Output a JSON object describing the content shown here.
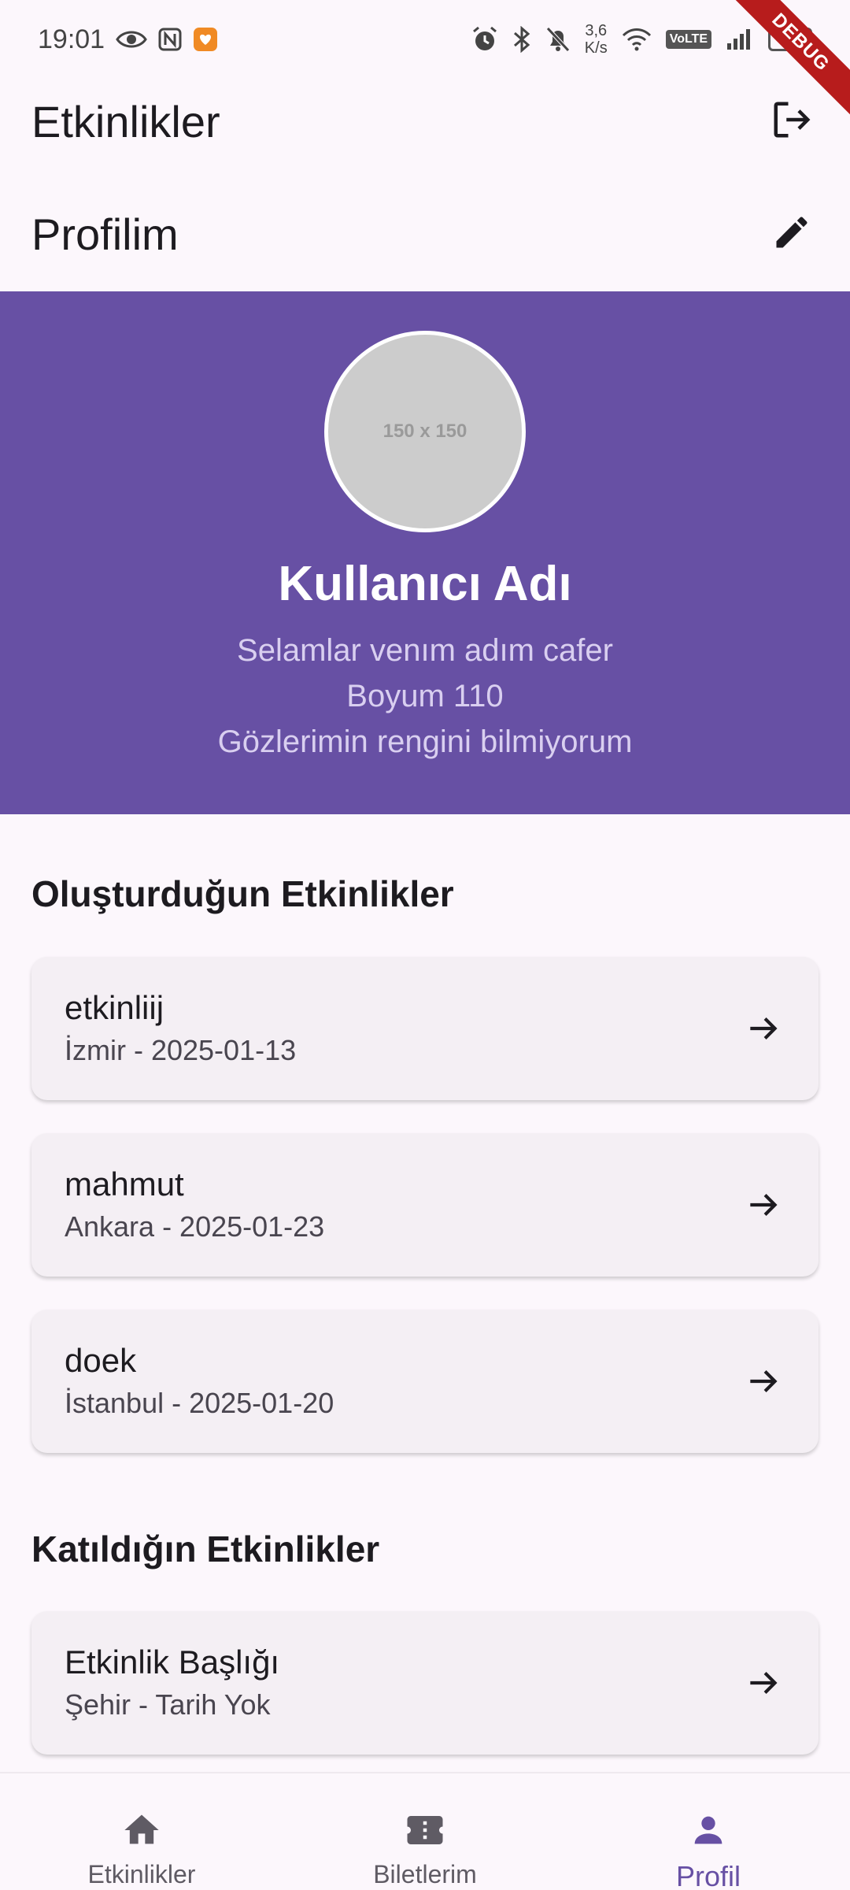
{
  "status_bar": {
    "time": "19:01",
    "speed_value": "3,6",
    "speed_unit": "K/s",
    "volte": "VoLTE",
    "battery": "97"
  },
  "debug_banner": "DEBUG",
  "app_bar": {
    "title": "Etkinlikler",
    "logout_icon": "logout-icon"
  },
  "profile": {
    "section_title": "Profilim",
    "edit_icon": "edit-icon",
    "avatar_placeholder": "150 x 150",
    "username": "Kullanıcı Adı",
    "bio_lines": [
      "Selamlar venım adım cafer",
      "Boyum 110",
      "Gözlerimin rengini bilmiyorum"
    ]
  },
  "created_events": {
    "title": "Oluşturduğun Etkinlikler",
    "items": [
      {
        "name": "etkinliij",
        "detail": "İzmir - 2025-01-13"
      },
      {
        "name": "mahmut",
        "detail": "Ankara - 2025-01-23"
      },
      {
        "name": "doek",
        "detail": "İstanbul - 2025-01-20"
      }
    ]
  },
  "joined_events": {
    "title": "Katıldığın Etkinlikler",
    "items": [
      {
        "name": "Etkinlik Başlığı",
        "detail": "Şehir - Tarih Yok"
      }
    ]
  },
  "bottom_nav": {
    "items": [
      {
        "label": "Etkinlikler",
        "icon": "home-icon"
      },
      {
        "label": "Biletlerim",
        "icon": "ticket-icon"
      },
      {
        "label": "Profil",
        "icon": "person-icon",
        "active": true
      }
    ]
  },
  "colors": {
    "primary": "#6750a4",
    "background": "#fcf7fc",
    "card": "#f4eff4"
  }
}
